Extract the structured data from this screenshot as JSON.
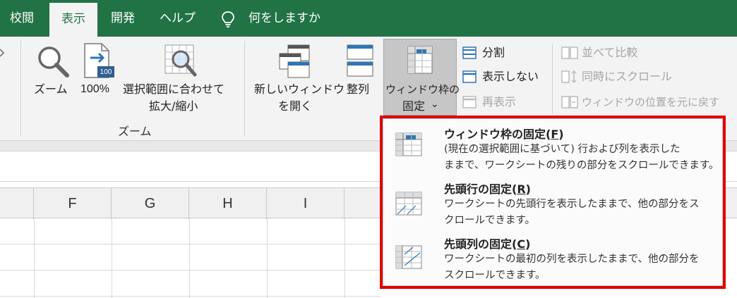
{
  "tabs": [
    {
      "label": "校閲",
      "active": false
    },
    {
      "label": "表示",
      "active": true
    },
    {
      "label": "開発",
      "active": false
    },
    {
      "label": "ヘルプ",
      "active": false
    }
  ],
  "tell_me": {
    "label": "何をしますか",
    "icon": "lightbulb-icon"
  },
  "ribbon": {
    "zoom_group": {
      "label": "ズーム",
      "buttons": {
        "zoom": "ズーム",
        "zoom100": "100%",
        "zoom100_badge": "100",
        "zoom_selection_line1": "選択範囲に合わせて",
        "zoom_selection_line2": "拡大/縮小"
      }
    },
    "window_group": {
      "new_window_line1": "新しいウィンドウ",
      "new_window_line2": "を開く",
      "arrange": "整列",
      "freeze_line1": "ウィンドウ枠の",
      "freeze_line2": "固定",
      "freeze_chevron": "⌄",
      "split": "分割",
      "hide": "表示しない",
      "unhide": "再表示",
      "side_by_side": "並べて比較",
      "sync_scroll": "同時にスクロール",
      "reset_position": "ウィンドウの位置を元に戻す"
    }
  },
  "columns": [
    "F",
    "G",
    "H",
    "I"
  ],
  "freeze_menu": {
    "items": [
      {
        "title": "ウィンドウ枠の固定(",
        "key": "F",
        "title_end": ")",
        "desc_line1": "(現在の選択範囲に基づいて) 行および列を表示した",
        "desc_line2": "ままで、ワークシートの残りの部分をスクロールできます。"
      },
      {
        "title": "先頭行の固定(",
        "key": "R",
        "title_end": ")",
        "desc_line1": "ワークシートの先頭行を表示したままで、他の部分をス",
        "desc_line2": "クロールできます。"
      },
      {
        "title": "先頭列の固定(",
        "key": "C",
        "title_end": ")",
        "desc_line1": "ワークシートの最初の列を表示したままで、他の部分を",
        "desc_line2": "スクロールできます。"
      }
    ]
  },
  "colors": {
    "brand_green": "#217346",
    "highlight_red": "#e00000",
    "accent_blue": "#2e75b6"
  }
}
